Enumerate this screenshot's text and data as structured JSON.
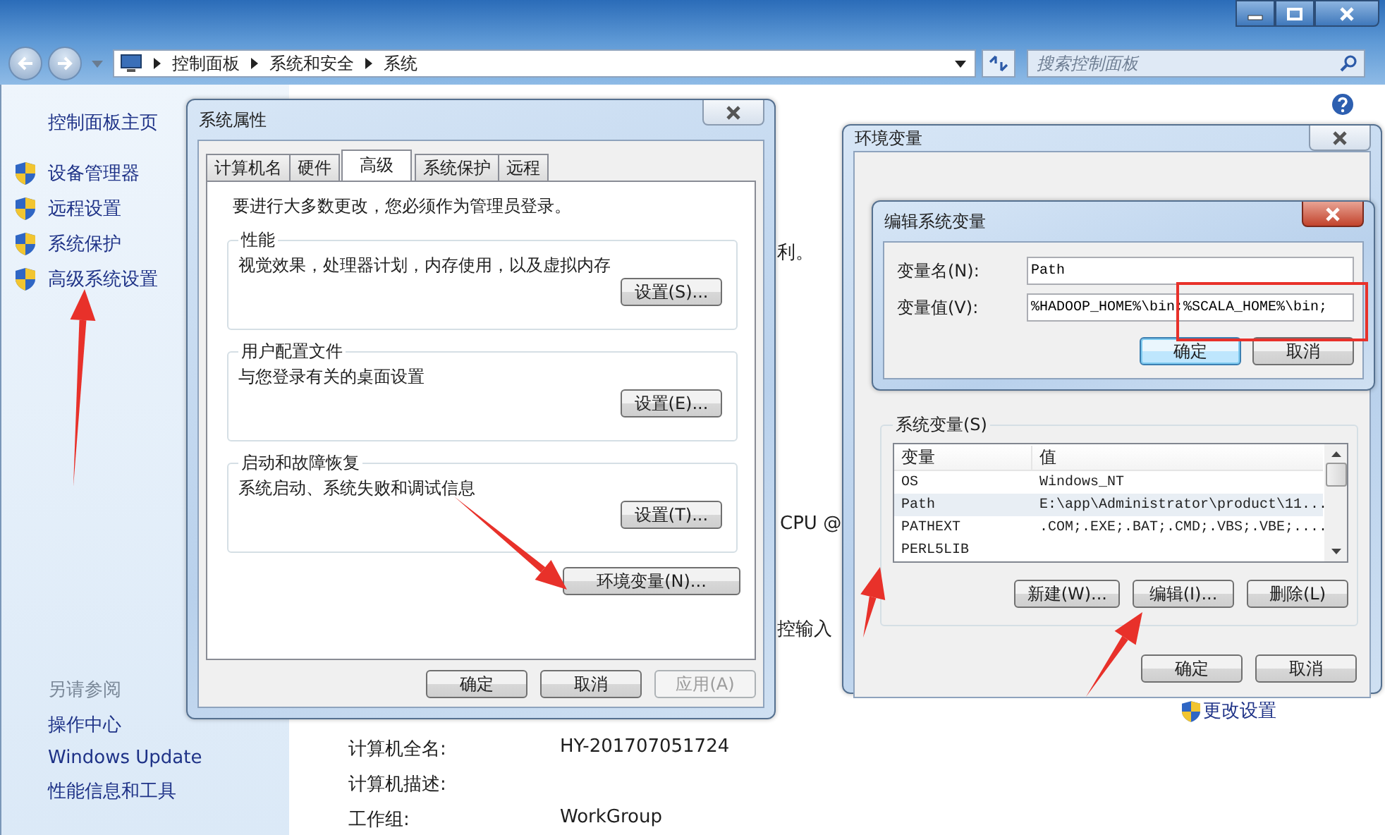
{
  "window": {
    "breadcrumb": [
      "控制面板",
      "系统和安全",
      "系统"
    ],
    "search": {
      "placeholder": "搜索控制面板"
    }
  },
  "sidebar": {
    "home": "控制面板主页",
    "items": [
      {
        "label": "设备管理器"
      },
      {
        "label": "远程设置"
      },
      {
        "label": "系统保护"
      },
      {
        "label": "高级系统设置"
      }
    ],
    "see_also": {
      "title": "另请参阅",
      "items": [
        "操作中心",
        "Windows Update",
        "性能信息和工具"
      ]
    }
  },
  "content": {
    "fragments": [
      "利。",
      "CPU @",
      "控输入"
    ],
    "change_link": "更改设置",
    "details": [
      {
        "label": "计算机全名:",
        "value": "HY-201707051724"
      },
      {
        "label": "计算机描述:"
      },
      {
        "label": "工作组:",
        "value": "WorkGroup"
      }
    ]
  },
  "system_properties": {
    "title": "系统属性",
    "tabs": [
      {
        "label": "计算机名",
        "selected": false
      },
      {
        "label": "硬件",
        "selected": false
      },
      {
        "label": "高级",
        "selected": true
      },
      {
        "label": "系统保护",
        "selected": false
      },
      {
        "label": "远程",
        "selected": false
      }
    ],
    "notice": "要进行大多数更改，您必须作为管理员登录。",
    "groups": [
      {
        "title": "性能",
        "description": "视觉效果，处理器计划，内存使用，以及虚拟内存",
        "button": "设置(S)..."
      },
      {
        "title": "用户配置文件",
        "description": "与您登录有关的桌面设置",
        "button": "设置(E)..."
      },
      {
        "title": "启动和故障恢复",
        "description": "系统启动、系统失败和调试信息",
        "button": "设置(T)..."
      }
    ],
    "env_button": "环境变量(N)...",
    "buttons": [
      {
        "label": "确定",
        "disabled": false
      },
      {
        "label": "取消",
        "disabled": false
      },
      {
        "label": "应用(A)",
        "disabled": true
      }
    ]
  },
  "environment_variables": {
    "title": "环境变量",
    "system_vars": {
      "title": "系统变量(S)",
      "columns": [
        "变量",
        "值"
      ],
      "rows": [
        {
          "name": "OS",
          "value": "Windows_NT",
          "selected": false
        },
        {
          "name": "Path",
          "value": "E:\\app\\Administrator\\product\\11...",
          "selected": true
        },
        {
          "name": "PATHEXT",
          "value": ".COM;.EXE;.BAT;.CMD;.VBS;.VBE;....",
          "selected": false
        },
        {
          "name": "PERL5LIB",
          "selected": false
        }
      ],
      "buttons": [
        "新建(W)...",
        "编辑(I)...",
        "删除(L)"
      ]
    },
    "buttons": [
      "确定",
      "取消"
    ]
  },
  "edit_dialog": {
    "title": "编辑系统变量",
    "fields": [
      {
        "label": "变量名(N):",
        "value": "Path"
      },
      {
        "label": "变量值(V):",
        "value": "%HADOOP_HOME%\\bin;%SCALA_HOME%\\bin;"
      }
    ],
    "buttons": [
      {
        "label": "确定",
        "default": true
      },
      {
        "label": "取消",
        "default": false
      }
    ]
  }
}
